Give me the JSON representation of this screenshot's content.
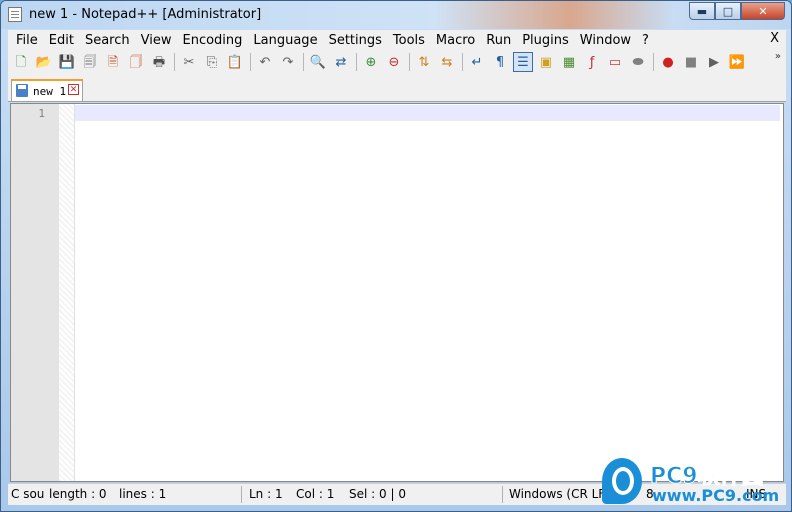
{
  "window": {
    "title": "new 1 - Notepad++ [Administrator]",
    "minimize_glyph": "▬",
    "maximize_glyph": "□",
    "close_glyph": "✕"
  },
  "menu": {
    "items": [
      "File",
      "Edit",
      "Search",
      "View",
      "Encoding",
      "Language",
      "Settings",
      "Tools",
      "Macro",
      "Run",
      "Plugins",
      "Window",
      "?"
    ],
    "close_label": "X"
  },
  "toolbar": {
    "icons": [
      {
        "name": "new-file-icon",
        "glyph": "🗋",
        "color": "#3a8f3a"
      },
      {
        "name": "open-file-icon",
        "glyph": "📂",
        "color": "#d4a020"
      },
      {
        "name": "save-icon",
        "glyph": "💾",
        "color": "#707070"
      },
      {
        "name": "save-all-icon",
        "glyph": "🗐",
        "color": "#707070"
      },
      {
        "name": "close-file-icon",
        "glyph": "🗎",
        "color": "#c05020"
      },
      {
        "name": "close-all-icon",
        "glyph": "🗍",
        "color": "#c05020"
      },
      {
        "name": "print-icon",
        "glyph": "🖶",
        "color": "#505050"
      },
      "sep",
      {
        "name": "cut-icon",
        "glyph": "✂",
        "color": "#606060"
      },
      {
        "name": "copy-icon",
        "glyph": "⎘",
        "color": "#606060"
      },
      {
        "name": "paste-icon",
        "glyph": "📋",
        "color": "#b08040"
      },
      "sep",
      {
        "name": "undo-icon",
        "glyph": "↶",
        "color": "#606060"
      },
      {
        "name": "redo-icon",
        "glyph": "↷",
        "color": "#606060"
      },
      "sep",
      {
        "name": "find-icon",
        "glyph": "🔍",
        "color": "#303030"
      },
      {
        "name": "replace-icon",
        "glyph": "⇄",
        "color": "#2060a0"
      },
      "sep",
      {
        "name": "zoom-in-icon",
        "glyph": "⊕",
        "color": "#3a8f3a"
      },
      {
        "name": "zoom-out-icon",
        "glyph": "⊖",
        "color": "#c03030"
      },
      "sep",
      {
        "name": "sync-vertical-icon",
        "glyph": "⇅",
        "color": "#d08020"
      },
      {
        "name": "sync-horizontal-icon",
        "glyph": "⇆",
        "color": "#d08020"
      },
      "sep",
      {
        "name": "word-wrap-icon",
        "glyph": "↵",
        "color": "#2060a0"
      },
      {
        "name": "show-all-chars-icon",
        "glyph": "¶",
        "color": "#2060a0"
      },
      {
        "name": "indent-guide-icon",
        "glyph": "☰",
        "color": "#2060a0",
        "active": true
      },
      {
        "name": "udl-icon",
        "glyph": "▣",
        "color": "#d0a020"
      },
      {
        "name": "document-map-icon",
        "glyph": "▦",
        "color": "#4a8a30"
      },
      {
        "name": "function-list-icon",
        "glyph": "ƒ",
        "color": "#c03030"
      },
      {
        "name": "folder-workspace-icon",
        "glyph": "▭",
        "color": "#c04040"
      },
      {
        "name": "monitoring-icon",
        "glyph": "⬬",
        "color": "#808080"
      },
      "sep",
      {
        "name": "record-macro-icon",
        "glyph": "●",
        "color": "#d02020"
      },
      {
        "name": "stop-macro-icon",
        "glyph": "■",
        "color": "#808080"
      },
      {
        "name": "play-macro-icon",
        "glyph": "▶",
        "color": "#606060"
      },
      {
        "name": "run-macro-multiple-icon",
        "glyph": "⏩",
        "color": "#2060c0"
      }
    ],
    "overflow_glyph": "»"
  },
  "tabs": [
    {
      "label": "new 1",
      "active": true
    }
  ],
  "editor": {
    "line_numbers": [
      "1"
    ],
    "current_line_color": "#e8e8ff"
  },
  "status": {
    "language": "C sou",
    "length": "length : 0",
    "lines": "lines : 1",
    "ln": "Ln : 1",
    "col": "Col : 1",
    "sel": "Sel : 0 | 0",
    "eol": "Windows (CR LF)",
    "encoding": "8",
    "mode": "INS"
  },
  "watermark": {
    "brand": "PC9软件园",
    "url": "www.PC9.com",
    "color": "#1a8fd8"
  }
}
